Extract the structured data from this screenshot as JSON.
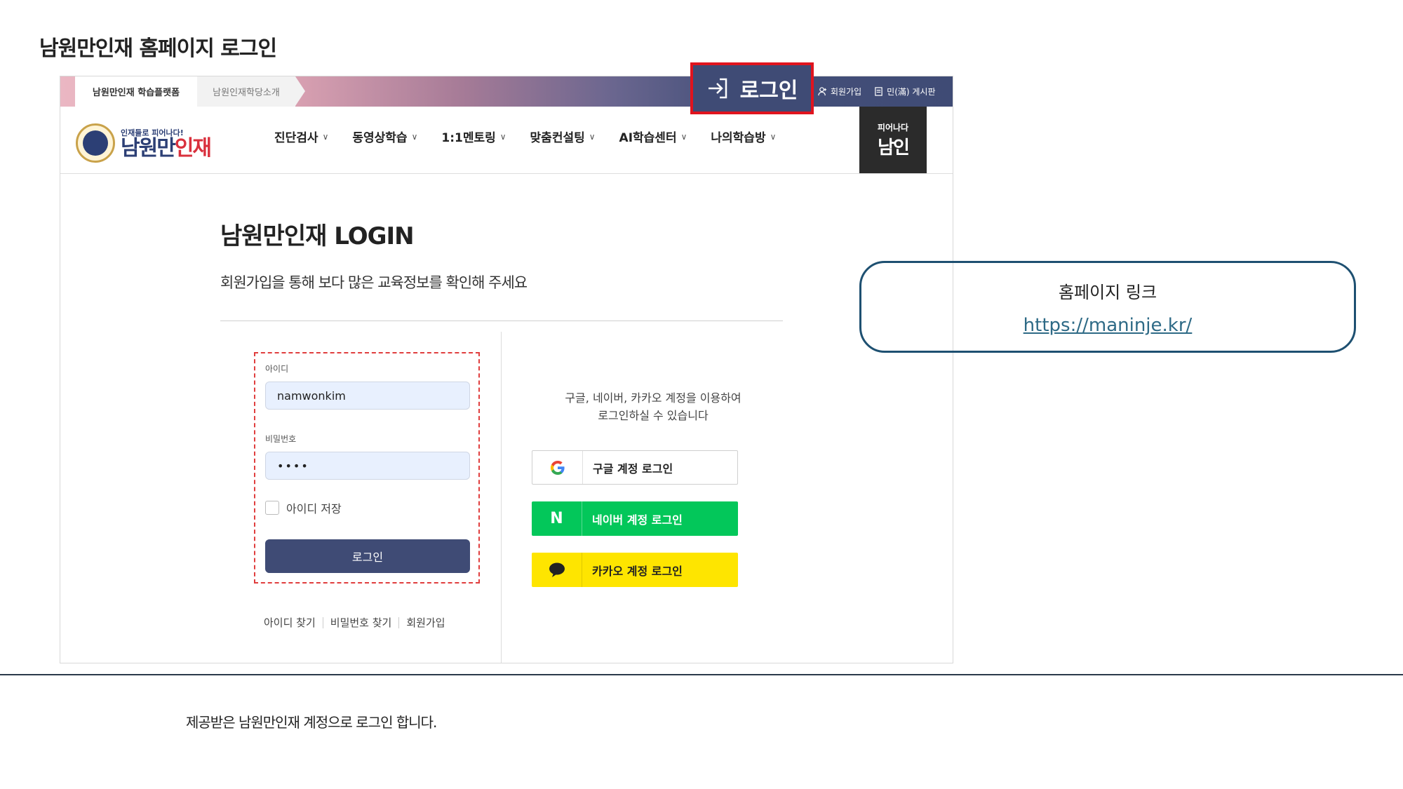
{
  "page_title": "남원만인재 홈페이지 로그인",
  "topbar": {
    "crumbs": [
      "남원만인재 학습플랫폼",
      "남원인재학당소개"
    ],
    "login_highlight_label": "로그인",
    "signup_label": "회원가입",
    "board_label": "민(滿) 게시판"
  },
  "header": {
    "logo_sub": "인재들로 피어나다!",
    "logo_main_a": "남원만",
    "logo_main_b": "인재",
    "menu": [
      "진단검사",
      "동영상학습",
      "1:1멘토링",
      "맞춤컨설팅",
      "AI학습센터",
      "나의학습방"
    ],
    "side_badge_top": "피어나다",
    "side_badge_main": "남인"
  },
  "login": {
    "heading": "남원만인재 LOGIN",
    "description": "회원가입을 통해 보다 많은 교육정보를 확인해 주세요",
    "id_label": "아이디",
    "id_value": "namwonkim",
    "pw_label": "비밀번호",
    "pw_value": "••••",
    "remember_label": "아이디 저장",
    "submit_label": "로그인",
    "find_links": [
      "아이디 찾기",
      "비밀번호 찾기",
      "회원가입"
    ]
  },
  "social": {
    "description": [
      "구글, 네이버, 카카오 계정을 이용하여",
      "로그인하실 수 있습니다"
    ],
    "google_label": "구글 계정 로그인",
    "naver_label": "네이버 계정 로그인",
    "kakao_label": "카카오 계정 로그인",
    "naver_icon_letter": "N"
  },
  "link_box": {
    "title": "홈페이지 링크",
    "url": "https://maninje.kr/"
  },
  "footer_note": "제공받은 남원만인재 계정으로 로그인 합니다.",
  "colors": {
    "primary": "#3f4b75",
    "highlight_border": "#e0141e",
    "naver": "#03c75a",
    "kakao": "#fee500",
    "link_box_border": "#1e5071"
  }
}
